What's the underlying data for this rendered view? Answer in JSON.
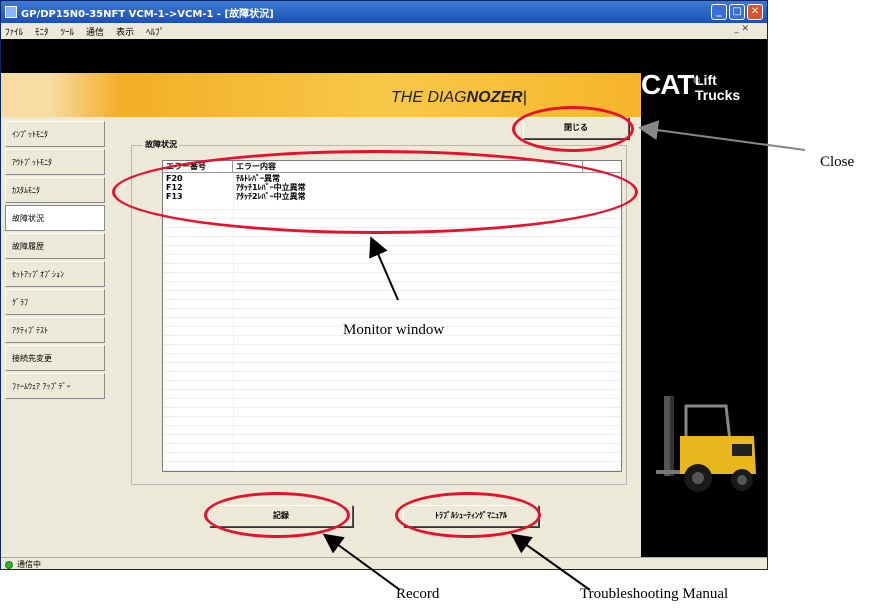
{
  "window": {
    "title": "GP/DP15N0-35NFT VCM-1->VCM-1 - [故障状況]",
    "menu": [
      "ﾌｧｲﾙ",
      "ﾓﾆﾀ",
      "ﾂｰﾙ",
      "通信",
      "表示",
      "ﾍﾙﾌﾟ"
    ],
    "mdi_controls": "_ ✕",
    "controls": {
      "minimize": "_",
      "maximize": "□",
      "close": "✕"
    }
  },
  "header": {
    "brand_prefix": "THE DIAG",
    "brand_bold": "NOZER",
    "brand_suffix": "|",
    "logo": "CAT",
    "logo_reg": "®",
    "logo_line1": "Lift",
    "logo_line2": "Trucks"
  },
  "sidebar": {
    "items": [
      {
        "label": "ｲﾝﾌﾟｯﾄﾓﾆﾀ",
        "active": false
      },
      {
        "label": "ｱｳﾄﾌﾟｯﾄﾓﾆﾀ",
        "active": false
      },
      {
        "label": "ｶｽﾀﾑﾓﾆﾀ",
        "active": false
      },
      {
        "label": "故障状況",
        "active": true
      },
      {
        "label": "故障履歴",
        "active": false
      },
      {
        "label": "ｾｯﾄｱｯﾌﾟｵﾌﾟｼｮﾝ",
        "active": false
      },
      {
        "label": "ｸﾞﾗﾌ",
        "active": false
      },
      {
        "label": "ｱｸﾃｨﾌﾞﾃｽﾄ",
        "active": false
      },
      {
        "label": "接続先変更",
        "active": false
      },
      {
        "label": "ﾌｧｰﾑｳｪｱ ｱｯﾌﾟﾃﾞｰ",
        "active": false
      }
    ]
  },
  "main": {
    "close_button": "閉じる",
    "group_label": "故障状況",
    "columns": [
      "エラー番号",
      "エラー内容"
    ],
    "rows": [
      {
        "code": "F20",
        "desc": "ﾁﾙﾄﾚﾊﾞｰ異常"
      },
      {
        "code": "F12",
        "desc": "ｱﾀｯﾁ1ﾚﾊﾞｰ中立異常"
      },
      {
        "code": "F13",
        "desc": "ｱﾀｯﾁ2ﾚﾊﾞｰ中立異常"
      }
    ],
    "record_button": "記録",
    "manual_button": "ﾄﾗﾌﾞﾙｼｭｰﾃｨﾝｸﾞﾏﾆｭｱﾙ"
  },
  "status": {
    "text": "通信中"
  },
  "annotations": {
    "close": "Close",
    "monitor": "Monitor window",
    "record": "Record",
    "manual": "Troubleshooting Manual"
  },
  "colors": {
    "annotation": "#e8112d",
    "accent": "#f5b82a"
  },
  "icons": [
    "app-icon",
    "status-dot-icon",
    "forklift-icon"
  ]
}
